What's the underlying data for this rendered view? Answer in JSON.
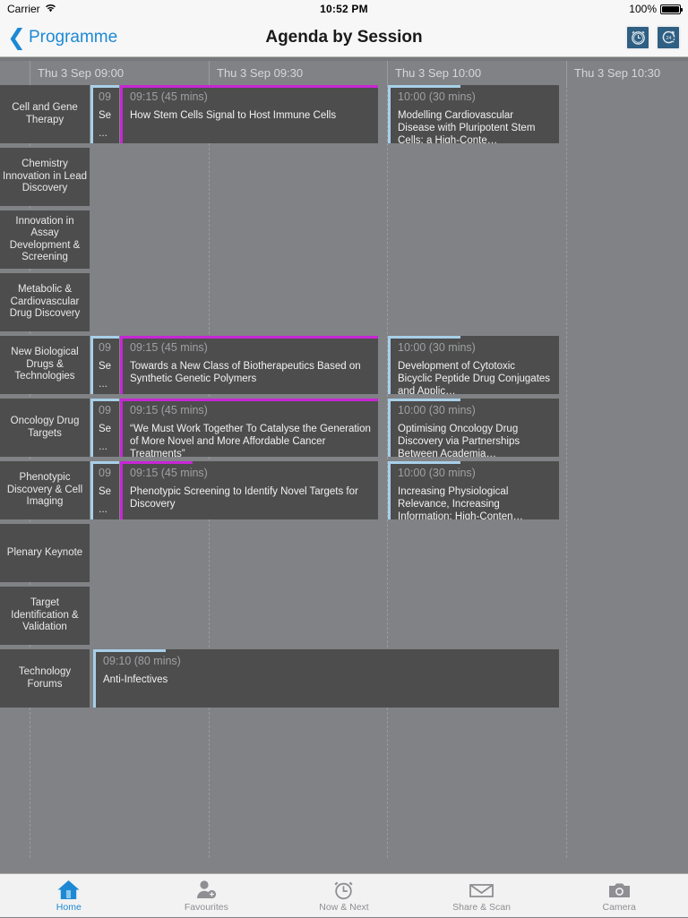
{
  "status_bar": {
    "carrier": "Carrier",
    "wifi_icon": "wifi-icon",
    "time": "10:52 PM",
    "battery_percent": "100%",
    "battery_icon": "battery-full-icon"
  },
  "nav_bar": {
    "back_label": "Programme",
    "back_icon": "chevron-left-icon",
    "title": "Agenda by Session",
    "actions": [
      {
        "name": "alarm-clock-icon",
        "label": "Reminders"
      },
      {
        "name": "twentyfour-hour-icon",
        "label": "24 Hour View"
      }
    ]
  },
  "timeline": {
    "columns": [
      "Thu 3 Sep 09:00",
      "Thu 3 Sep 09:30",
      "Thu 3 Sep 10:00",
      "Thu 3 Sep 10:30"
    ]
  },
  "tracks": [
    {
      "label": "Cell and Gene Therapy"
    },
    {
      "label": "Chemistry Innovation in Lead Discovery"
    },
    {
      "label": "Innovation in Assay Development & Screening"
    },
    {
      "label": "Metabolic & Cardiovascular Drug Discovery"
    },
    {
      "label": "New Biological Drugs & Technologies"
    },
    {
      "label": "Oncology Drug Targets"
    },
    {
      "label": "Phenotypic Discovery & Cell Imaging"
    },
    {
      "label": "Plenary Keynote"
    },
    {
      "label": "Target Identification & Validation"
    },
    {
      "label": "Technology Forums"
    }
  ],
  "sessions": {
    "row0": {
      "clipped": {
        "time": "09",
        "name": "Se",
        "more": "..."
      },
      "main": {
        "time": "09:15 (45 mins)",
        "name": "How Stem Cells Signal to Host Immune Cells"
      },
      "second": {
        "time": "10:00 (30 mins)",
        "name": "Modelling Cardiovascular Disease with Pluripotent Stem Cells: a High-Conte…"
      }
    },
    "row4": {
      "clipped": {
        "time": "09",
        "name": "Se",
        "more": "..."
      },
      "main": {
        "time": "09:15 (45 mins)",
        "name": "Towards a New Class of Biotherapeutics Based on Synthetic Genetic Polymers"
      },
      "second": {
        "time": "10:00 (30 mins)",
        "name": "Development of Cytotoxic Bicyclic Peptide Drug Conjugates and Applic…"
      }
    },
    "row5": {
      "clipped": {
        "time": "09",
        "name": "Se",
        "more": "..."
      },
      "main": {
        "time": "09:15 (45 mins)",
        "name": "“We Must Work Together To Catalyse the Generation of More Novel and More Affordable Cancer Treatments”"
      },
      "second": {
        "time": "10:00 (30 mins)",
        "name": "Optimising Oncology Drug Discovery via Partnerships Between Academia…"
      }
    },
    "row6": {
      "clipped": {
        "time": "09",
        "name": "Se",
        "more": "..."
      },
      "main": {
        "time": "09:15 (45 mins)",
        "name": "Phenotypic Screening to Identify Novel Targets for Discovery"
      },
      "second": {
        "time": "10:00 (30 mins)",
        "name": "Increasing Physiological Relevance, Increasing Information: High-Conten…"
      }
    },
    "row9": {
      "main": {
        "time": "09:10 (80 mins)",
        "name": "Anti-Infectives"
      }
    }
  },
  "tab_bar": {
    "items": [
      {
        "label": "Home",
        "icon": "home-icon",
        "active": true
      },
      {
        "label": "Favourites",
        "icon": "person-add-icon",
        "active": false
      },
      {
        "label": "Now & Next",
        "icon": "alarm-clock-icon",
        "active": false
      },
      {
        "label": "Share & Scan",
        "icon": "envelope-icon",
        "active": false
      },
      {
        "label": "Camera",
        "icon": "camera-icon",
        "active": false
      }
    ]
  },
  "colors": {
    "background": "#808285",
    "block": "#4d4d4d",
    "accent_blue": "#a8cfe8",
    "accent_magenta": "#c726d4",
    "link": "#1d89d4",
    "nav_button": "#2f5f82"
  }
}
